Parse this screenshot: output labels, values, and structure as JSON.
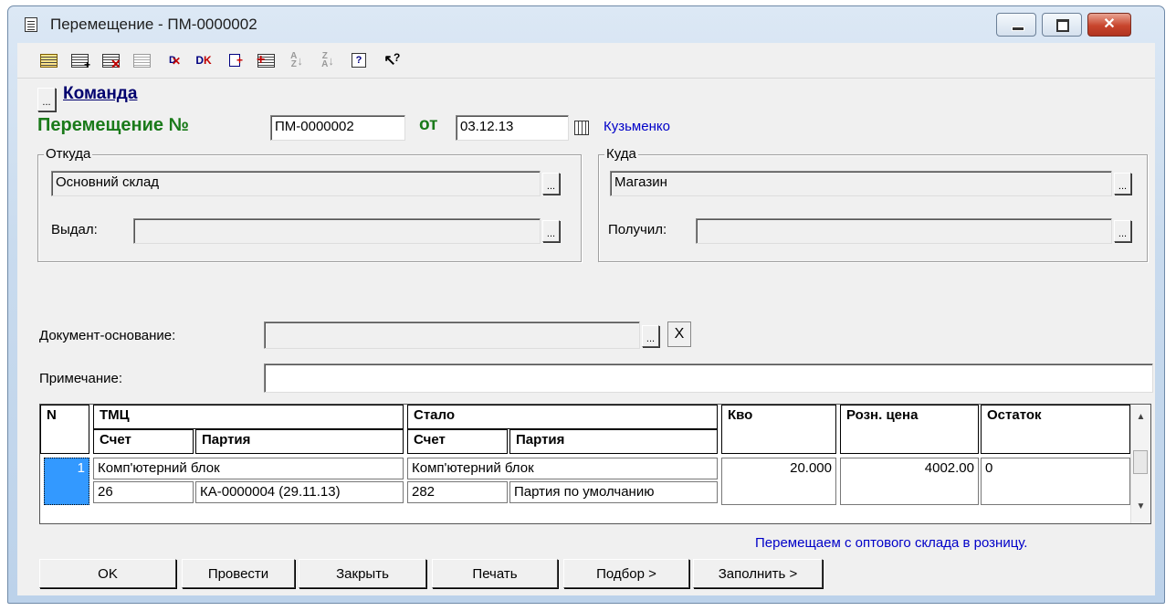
{
  "window": {
    "title": "Перемещение - ПМ-0000002"
  },
  "toolbar": {
    "icons": [
      "new-row",
      "add-row",
      "delete-row",
      "copy-row",
      "delete-doc",
      "mark-delete",
      "insert",
      "select-rows",
      "sort-asc",
      "sort-desc",
      "help",
      "context-help"
    ]
  },
  "header": {
    "command_label": "Команда",
    "doc_label": "Перемещение №",
    "doc_number": "ПМ-0000002",
    "date_label": "от",
    "date_value": "03.12.13",
    "author": "Кузьменко"
  },
  "from": {
    "group_title": "Откуда",
    "warehouse": "Основний склад",
    "issued_label": "Выдал:",
    "issued_value": ""
  },
  "to": {
    "group_title": "Куда",
    "warehouse": "Магазин",
    "received_label": "Получил:",
    "received_value": ""
  },
  "basis": {
    "label": "Документ-основание:",
    "value": "",
    "clear": "X"
  },
  "note": {
    "label": "Примечание:",
    "value": ""
  },
  "table": {
    "headers": {
      "n": "N",
      "tmc": "ТМЦ",
      "tmc_account": "Счет",
      "tmc_batch": "Партия",
      "became": "Стало",
      "became_account": "Счет",
      "became_batch": "Партия",
      "qty": "Кво",
      "price": "Розн. цена",
      "stock": "Остаток"
    },
    "rows": [
      {
        "n": "1",
        "tmc": "Комп'ютерний блок",
        "tmc_account": "26",
        "tmc_batch": "КА-0000004 (29.11.13)",
        "became": "Комп'ютерний блок",
        "became_account": "282",
        "became_batch": "Партия по умолчанию",
        "qty": "20.000",
        "price": "4002.00",
        "stock": "0"
      }
    ]
  },
  "hint": "Перемещаем с оптового склада в розницу.",
  "buttons": {
    "ok": "OK",
    "post": "Провести",
    "close": "Закрыть",
    "print": "Печать",
    "select": "Подбор >",
    "fill": "Заполнить >"
  }
}
